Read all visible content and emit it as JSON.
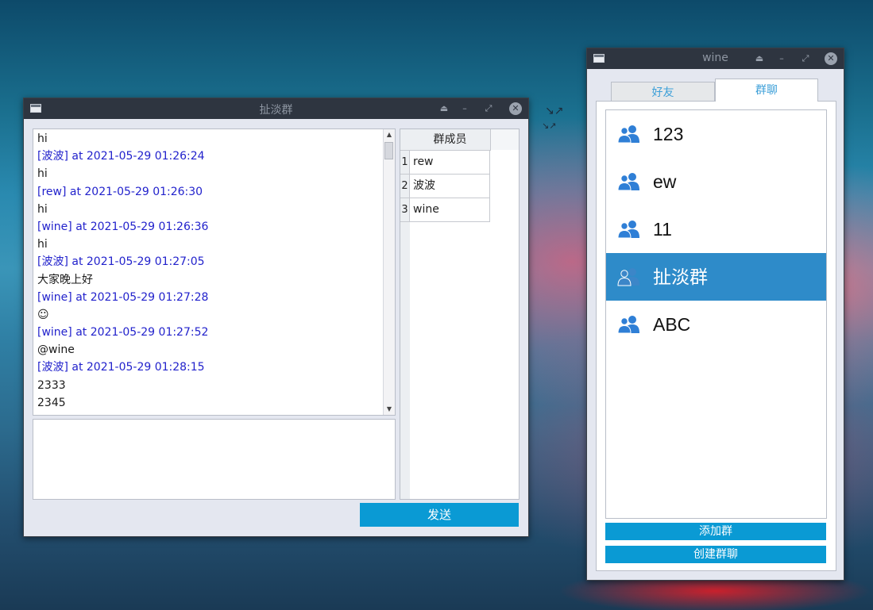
{
  "chat_window": {
    "title": "扯淡群",
    "messages": [
      {
        "text": "hi",
        "type": "content"
      },
      {
        "text": "[波波] at 2021-05-29 01:26:24",
        "type": "meta"
      },
      {
        "text": "hi",
        "type": "content"
      },
      {
        "text": "[rew] at 2021-05-29 01:26:30",
        "type": "meta"
      },
      {
        "text": "hi",
        "type": "content"
      },
      {
        "text": "[wine] at 2021-05-29 01:26:36",
        "type": "meta"
      },
      {
        "text": "hi",
        "type": "content"
      },
      {
        "text": "[波波] at 2021-05-29 01:27:05",
        "type": "meta"
      },
      {
        "text": "大家晚上好",
        "type": "content"
      },
      {
        "text": "[wine] at 2021-05-29 01:27:28",
        "type": "meta"
      },
      {
        "text": "☺",
        "type": "content"
      },
      {
        "text": "[wine] at 2021-05-29 01:27:52",
        "type": "meta"
      },
      {
        "text": "@wine",
        "type": "content"
      },
      {
        "text": "[波波] at 2021-05-29 01:28:15",
        "type": "meta"
      },
      {
        "text": "2333",
        "type": "content"
      },
      {
        "text": "2345",
        "type": "content"
      }
    ],
    "input_value": "",
    "members_header": "群成员",
    "members": [
      {
        "num": "1",
        "name": "rew"
      },
      {
        "num": "2",
        "name": "波波"
      },
      {
        "num": "3",
        "name": "wine"
      }
    ],
    "send_label": "发送"
  },
  "main_window": {
    "title": "wine",
    "tabs": [
      {
        "label": "好友",
        "active": false
      },
      {
        "label": "群聊",
        "active": true
      }
    ],
    "groups": [
      {
        "name": "123",
        "selected": false
      },
      {
        "name": "ew",
        "selected": false
      },
      {
        "name": "11",
        "selected": false
      },
      {
        "name": "扯淡群",
        "selected": true
      },
      {
        "name": "ABC",
        "selected": false
      }
    ],
    "add_group_label": "添加群",
    "create_group_label": "创建群聊"
  },
  "colors": {
    "accent": "#0a9ad4",
    "selection": "#2e8bc9",
    "meta_text": "#2222cc",
    "group_icon": "#2f7fd6"
  }
}
